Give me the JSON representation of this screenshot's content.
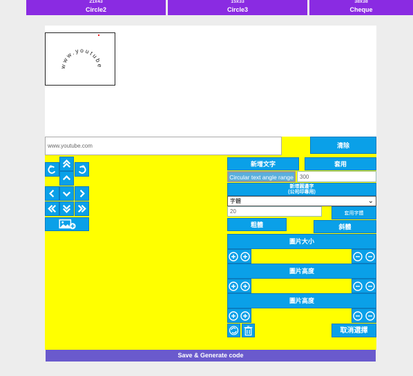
{
  "tabs": [
    {
      "sub": "21x43",
      "label": "Circle2"
    },
    {
      "sub": "15x33",
      "label": "Circle3"
    },
    {
      "sub": "38x38",
      "label": "Cheque"
    }
  ],
  "stamp": {
    "arc_text": "www.youtube.com"
  },
  "text_input": {
    "value": "www.youtube.com"
  },
  "buttons": {
    "clear": "清除",
    "add_text": "新增文字",
    "apply": "套用",
    "circular_angle": "Circular text angle range",
    "add_circle_text_line1": "新增圓邊字",
    "add_circle_text_line2": "(公司印專用)",
    "apply_font": "套用字體",
    "bold": "粗體",
    "italic": "斜體",
    "cancel_select": "取消選擇",
    "save_generate": "Save & Generate code"
  },
  "angle_input": {
    "value": "300"
  },
  "font_select": {
    "value": "字體"
  },
  "font_size_input": {
    "value": "20"
  },
  "sections": {
    "image_size": "圖片大小",
    "image_height_1": "圖片高度",
    "image_height_2": "圖片高度"
  },
  "colors": {
    "accent_blue": "#0aa0e8",
    "panel_yellow": "#ffff00",
    "tab_purple": "#8a2be2",
    "save_bar": "#6a5acd"
  }
}
